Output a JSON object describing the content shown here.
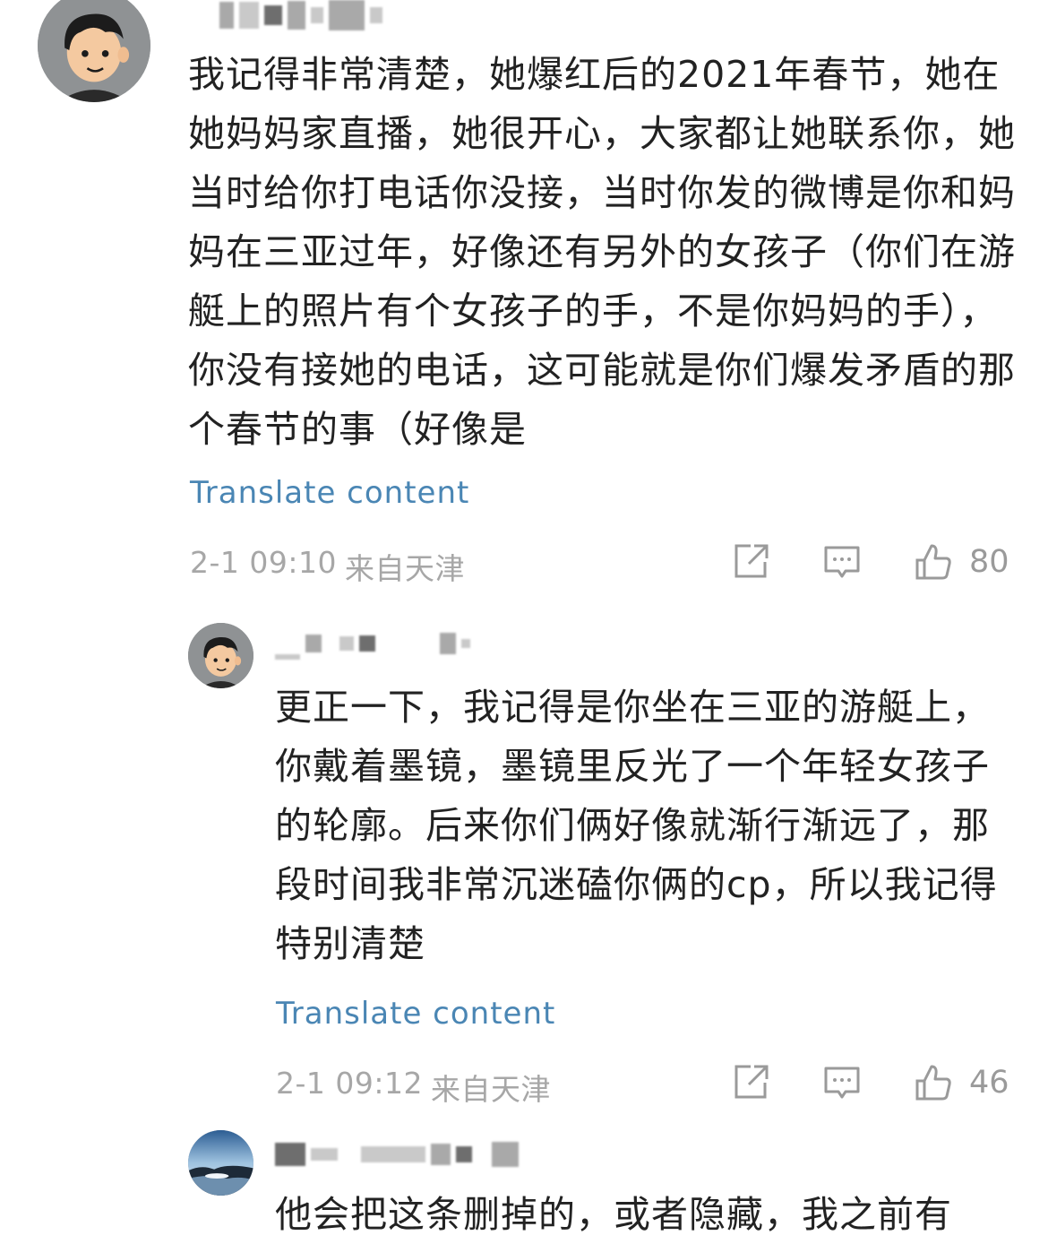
{
  "comments": [
    {
      "text": "我记得非常清楚，她爆红后的2021年春节，她在她妈妈家直播，她很开心，大家都让她联系你，她当时给你打电话你没接，当时你发的微博是你和妈妈在三亚过年，好像还有另外的女孩子（你们在游艇上的照片有个女孩子的手，不是你妈妈的手），你没有接她的电话，这可能就是你们爆发矛盾的那个春节的事（好像是",
      "translate_label": "Translate content",
      "timestamp": "2-1 09:10",
      "location": "来自天津",
      "likes": "80"
    },
    {
      "text": "更正一下，我记得是你坐在三亚的游艇上，你戴着墨镜，墨镜里反光了一个年轻女孩子的轮廓。后来你们俩好像就渐行渐远了，那段时间我非常沉迷磕你俩的cp，所以我记得特别清楚",
      "translate_label": "Translate content",
      "timestamp": "2-1 09:12",
      "location": "来自天津",
      "likes": "46"
    },
    {
      "text": "他会把这条删掉的，或者隐藏，我之前有"
    }
  ],
  "icons": {
    "share": "share-icon",
    "comment": "comment-icon",
    "like": "thumbs-up-icon"
  },
  "colors": {
    "translate_link": "#4a86b4",
    "meta_text": "#a7a7a7"
  }
}
